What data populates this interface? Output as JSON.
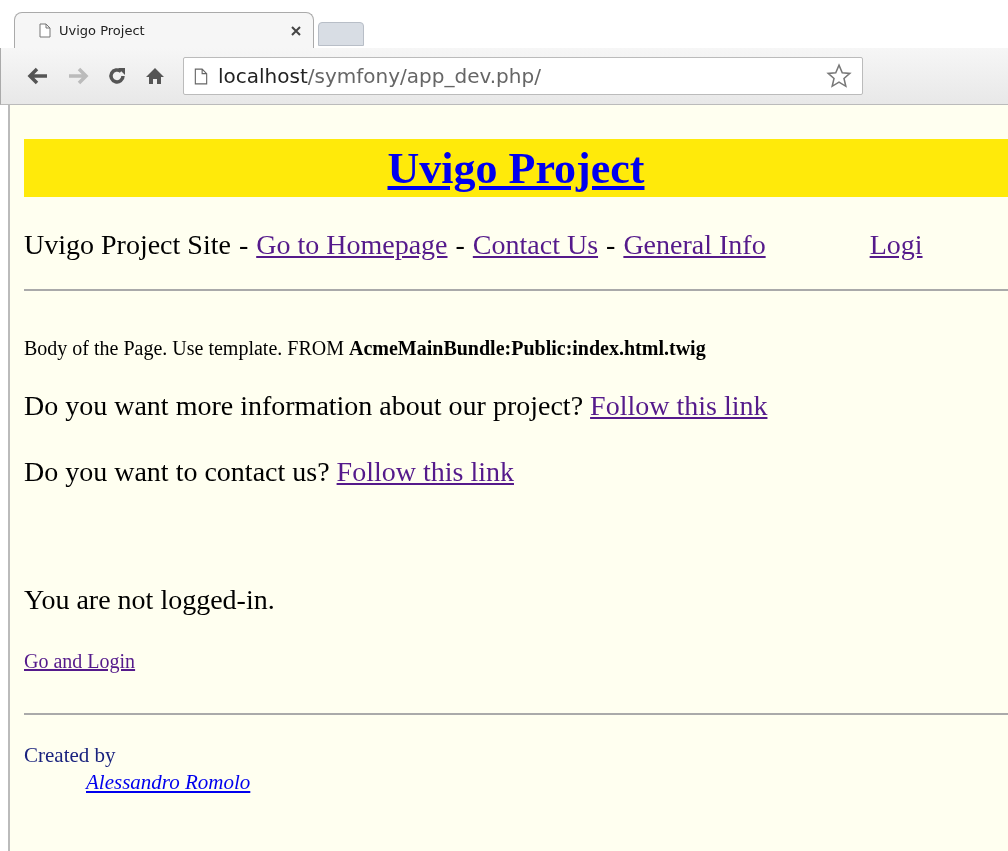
{
  "browser": {
    "tab_title": "Uvigo Project",
    "url_host": "localhost",
    "url_path": "/symfony/app_dev.php/"
  },
  "header": {
    "title": "Uvigo Project"
  },
  "nav": [
    {
      "kind": "text",
      "text": "Uvigo Project Site"
    },
    {
      "kind": "separator",
      "text": "-"
    },
    {
      "kind": "link",
      "text": "Go to Homepage"
    },
    {
      "kind": "separator",
      "text": "-"
    },
    {
      "kind": "link",
      "text": "Contact Us"
    },
    {
      "kind": "separator",
      "text": "-"
    },
    {
      "kind": "link",
      "text": "General Info"
    }
  ],
  "login_link": "Logi",
  "body_note": "Body of the Page. Use template. FROM **AcmeMainBundle:Public:index.html.twig**",
  "paragraphs": [
    {
      "text": "Do you want more information about our project?",
      "link": "Follow this link"
    },
    {
      "text": "Do you want to contact us?",
      "link": "Follow this link"
    }
  ],
  "status": "You are not logged-in.",
  "status_link": "Go and Login",
  "footer": {
    "label": "Created by",
    "author": "Alessandro Romolo"
  }
}
